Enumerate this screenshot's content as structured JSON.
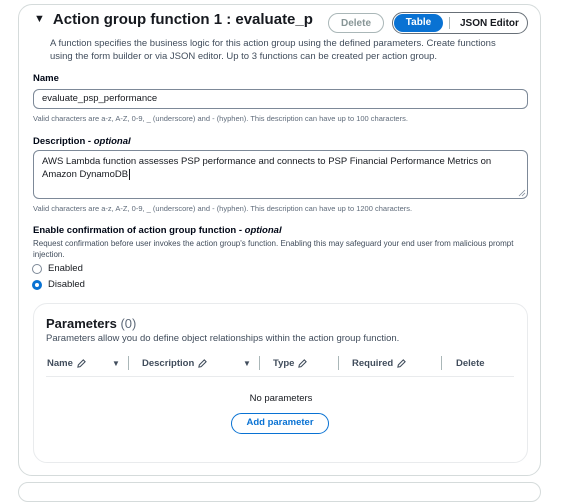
{
  "function_header": {
    "title": "Action group function 1 : evaluate_p",
    "description": "A function specifies the business logic for this action group using the defined parameters. Create functions using the form builder or via JSON editor. Up to 3 functions can be created per action group.",
    "delete_label": "Delete",
    "view_modes": [
      "Table",
      "JSON Editor"
    ],
    "selected_view": "Table"
  },
  "name_field": {
    "label": "Name",
    "value": "evaluate_psp_performance",
    "hint": "Valid characters are a-z, A-Z, 0-9, _ (underscore) and - (hyphen). This description can have up to 100 characters."
  },
  "description_field": {
    "label": "Description",
    "optional": "- optional",
    "value": "AWS Lambda function assesses PSP performance and connects to PSP Financial Performance Metrics on Amazon DynamoDB",
    "hint": "Valid characters are a-z, A-Z, 0-9, _ (underscore) and - (hyphen). This description can have up to 1200 characters."
  },
  "confirmation": {
    "label": "Enable confirmation of action group function",
    "optional": "- optional",
    "description": "Request confirmation before user invokes the action group's function. Enabling this may safeguard your end user from malicious prompt injection.",
    "options": [
      "Enabled",
      "Disabled"
    ],
    "selected": "Disabled"
  },
  "parameters": {
    "title": "Parameters",
    "count": "(0)",
    "description": "Parameters allow you do define object relationships within the action group function.",
    "columns": [
      "Name",
      "Description",
      "Type",
      "Required",
      "Delete"
    ],
    "empty_text": "No parameters",
    "add_label": "Add parameter"
  },
  "icons": {
    "caret": "caret-down-icon",
    "pencil": "pencil-icon",
    "sort": "sort-down-icon",
    "resize": "resize-grip-icon"
  },
  "colors": {
    "accent": "#0972d3",
    "border": "#7d8998",
    "muted_text": "#5f6b7a"
  }
}
